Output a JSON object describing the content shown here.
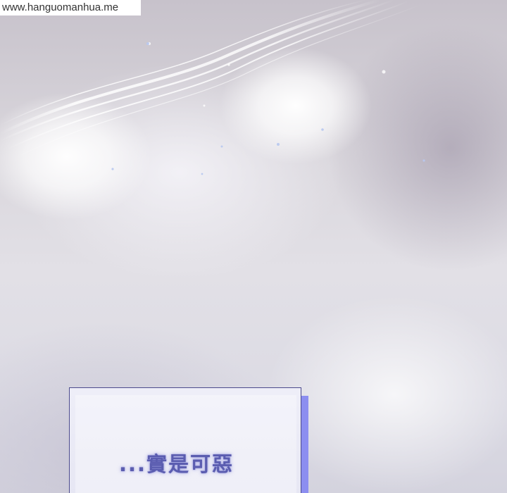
{
  "watermark": {
    "text": "www.hanguomanhua.me"
  },
  "speech": {
    "text": "...實是可惡"
  },
  "colors": {
    "box_border": "#4b4a8c",
    "box_shadow": "#8c8ef0",
    "text": "#5b5db0"
  }
}
